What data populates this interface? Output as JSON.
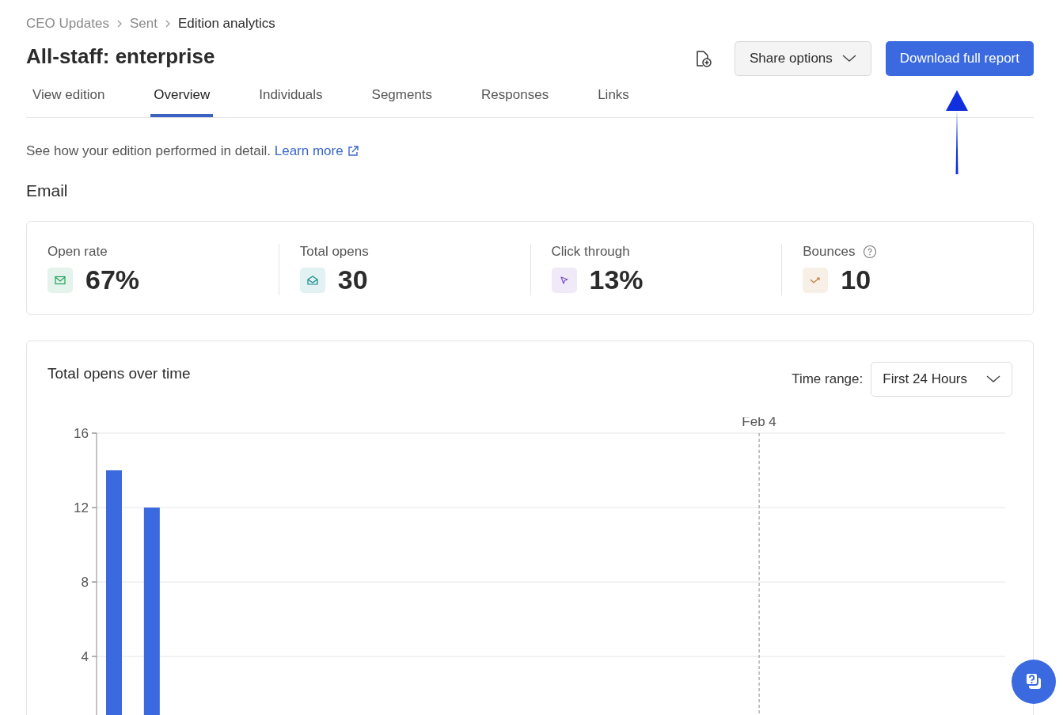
{
  "breadcrumb": [
    {
      "label": "CEO Updates",
      "current": false
    },
    {
      "label": "Sent",
      "current": false
    },
    {
      "label": "Edition analytics",
      "current": true
    }
  ],
  "title": "All-staff: enterprise",
  "actions": {
    "share_label": "Share options",
    "download_label": "Download full report"
  },
  "tabs": [
    {
      "label": "View edition",
      "selected": false
    },
    {
      "label": "Overview",
      "selected": true
    },
    {
      "label": "Individuals",
      "selected": false
    },
    {
      "label": "Segments",
      "selected": false
    },
    {
      "label": "Responses",
      "selected": false
    },
    {
      "label": "Links",
      "selected": false
    }
  ],
  "intro": {
    "text": "See how your edition performed in detail.",
    "link": "Learn more"
  },
  "section_title": "Email",
  "stats": [
    {
      "label": "Open rate",
      "value": "67%",
      "kind": "mail",
      "color": "#22a05a",
      "help": false
    },
    {
      "label": "Total opens",
      "value": "30",
      "kind": "open-mail",
      "color": "#148a8f",
      "help": false
    },
    {
      "label": "Click through",
      "value": "13%",
      "kind": "cursor",
      "color": "#7b4bc4",
      "help": false
    },
    {
      "label": "Bounces",
      "value": "10",
      "kind": "bounce",
      "color": "#c9793a",
      "help": true
    }
  ],
  "chart_card": {
    "title": "Total opens over time",
    "range_label": "Time range:",
    "range_value": "First 24 Hours",
    "marker_label": "Feb 4",
    "chart_data": {
      "type": "bar",
      "values": [
        14,
        12,
        0,
        0,
        0,
        0,
        0,
        0,
        0,
        0,
        0,
        0,
        0,
        0,
        0,
        0,
        0,
        0,
        0,
        0,
        0,
        0,
        0,
        0
      ],
      "ylim": [
        0,
        16
      ],
      "yticks": [
        4,
        8,
        12,
        16
      ],
      "grid": true
    }
  }
}
